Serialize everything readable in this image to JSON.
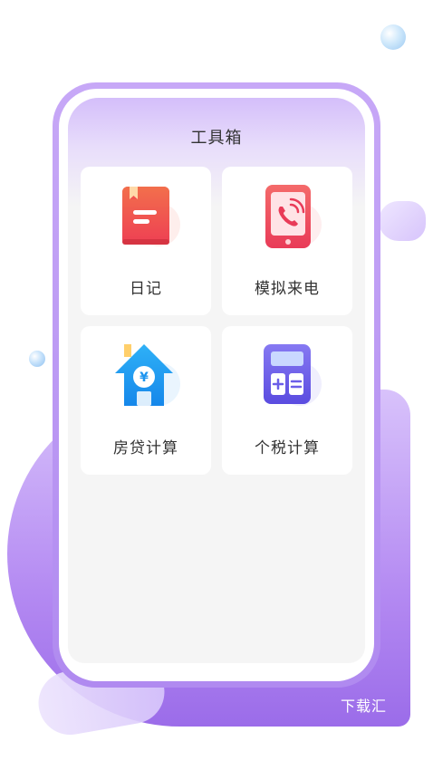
{
  "screen": {
    "title": "工具箱"
  },
  "tools": [
    {
      "label": "日记",
      "icon": "diary-book-icon",
      "color": "#f2544f"
    },
    {
      "label": "模拟来电",
      "icon": "phone-call-icon",
      "color": "#ef4a5e"
    },
    {
      "label": "房贷计算",
      "icon": "house-yuan-icon",
      "color": "#1e95ef"
    },
    {
      "label": "个税计算",
      "icon": "calculator-icon",
      "color": "#6b5ee8"
    }
  ],
  "watermark": "下载汇",
  "colors": {
    "accent_purple": "#b08af0",
    "background": "#f5f5f5"
  }
}
